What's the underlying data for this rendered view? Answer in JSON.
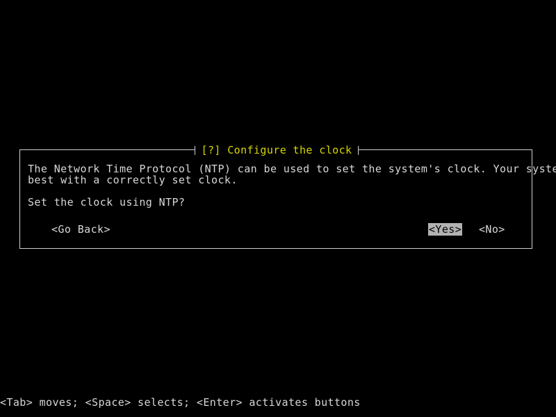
{
  "screen": {
    "background_color": "#000000",
    "foreground_color": "#d8d8d8",
    "accent_color": "#d7d700",
    "highlight_bg_color": "#b2b2b2",
    "highlight_fg_color": "#000000"
  },
  "dialog": {
    "title": "[?] Configure the clock",
    "paragraph_lines": [
      "The Network Time Protocol (NTP) can be used to set the system's clock. Your system works",
      "best with a correctly set clock."
    ],
    "question": "Set the clock using NTP?",
    "buttons": [
      {
        "label": "<Go Back>",
        "selected": false
      },
      {
        "label": "<Yes>",
        "selected": true
      },
      {
        "label": "<No>",
        "selected": false
      }
    ]
  },
  "helpbar": {
    "text": "<Tab> moves; <Space> selects; <Enter> activates buttons"
  }
}
